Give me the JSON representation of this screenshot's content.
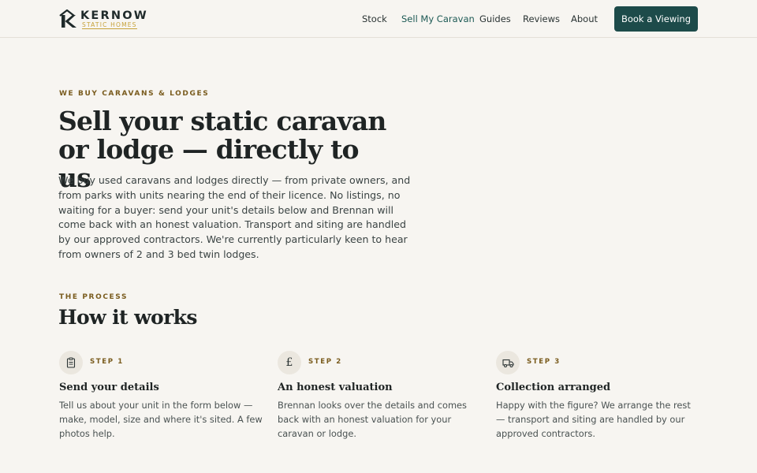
{
  "brand": {
    "name": "KERNOW",
    "tagline": "STATIC HOMES",
    "mark_letter": "K",
    "accent_color": "#c7a23a"
  },
  "nav": {
    "items": [
      {
        "label": "Stock",
        "active": false
      },
      {
        "label": "Sell My Caravan",
        "active": true
      },
      {
        "label": "Guides",
        "active": false
      },
      {
        "label": "Reviews",
        "active": false
      },
      {
        "label": "About",
        "active": false
      }
    ],
    "cta_label": "Book a Viewing",
    "cta_color": "#1d4b4a"
  },
  "hero": {
    "eyebrow": "WE BUY CARAVANS & LODGES",
    "title_line1": "Sell your static caravan",
    "title_line2": "or lodge — directly to us",
    "body": "We buy used caravans and lodges directly — from private owners, and from parks with units nearing the end of their licence. No listings, no waiting for a buyer: send your unit's details below and Brennan will come back with an honest valuation. Transport and siting are handled by our approved contractors. We're currently particularly keen to hear from owners of 2 and 3 bed twin lodges."
  },
  "process": {
    "eyebrow": "THE PROCESS",
    "title": "How it works",
    "steps": [
      {
        "icon": "clipboard-icon",
        "label": "STEP 1",
        "title": "Send your details",
        "body": "Tell us about your unit in the form below — make, model, size and where it's sited. A few photos help."
      },
      {
        "icon": "pound-icon",
        "label": "STEP 2",
        "title": "An honest valuation",
        "body": "Brennan looks over the details and comes back with an honest valuation for your caravan or lodge."
      },
      {
        "icon": "truck-icon",
        "label": "STEP 3",
        "title": "Collection arranged",
        "body": "Happy with the figure? We arrange the rest — transport and siting are handled by our approved contractors."
      }
    ]
  }
}
